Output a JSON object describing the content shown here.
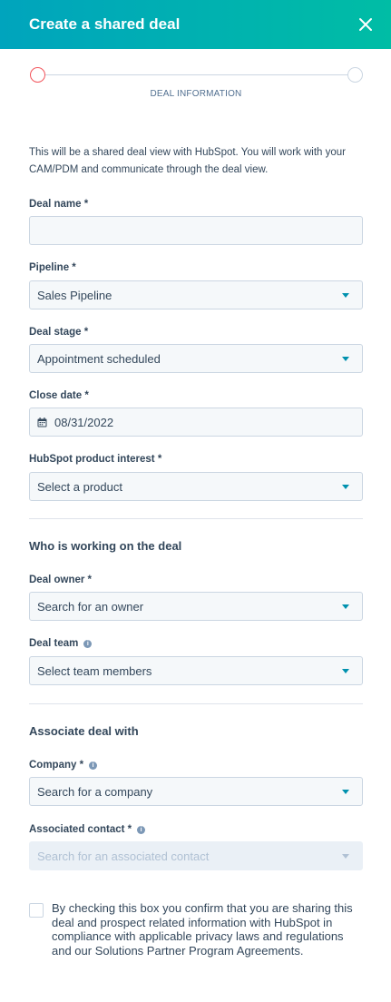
{
  "header": {
    "title": "Create a shared deal"
  },
  "stepper": {
    "label": "DEAL INFORMATION"
  },
  "intro": "This will be a shared deal view with HubSpot. You will work with your CAM/PDM and communicate through the deal view.",
  "fields": {
    "deal_name": {
      "label": "Deal name *",
      "value": ""
    },
    "pipeline": {
      "label": "Pipeline *",
      "value": "Sales Pipeline"
    },
    "deal_stage": {
      "label": "Deal stage *",
      "value": "Appointment scheduled"
    },
    "close_date": {
      "label": "Close date *",
      "value": "08/31/2022"
    },
    "product_interest": {
      "label": "HubSpot product interest *",
      "value": "Select a product"
    }
  },
  "sections": {
    "working": "Who is working on the deal",
    "associate": "Associate deal with"
  },
  "owner": {
    "deal_owner": {
      "label": "Deal owner *",
      "value": "Search for an owner"
    },
    "deal_team": {
      "label": "Deal team",
      "value": "Select team members"
    }
  },
  "associate": {
    "company": {
      "label": "Company *",
      "value": "Search for a company"
    },
    "contact": {
      "label": "Associated contact *",
      "value": "Search for an associated contact"
    }
  },
  "consent": "By checking this box you confirm that you are sharing this deal and prospect related information with HubSpot in compliance with applicable privacy laws and regulations and our Solutions Partner Program Agreements.",
  "colors": {
    "header_start": "#00a4bd",
    "header_end": "#00bda5",
    "accent": "#0091ae",
    "active_step": "#f2545b"
  },
  "icons": {
    "close": "close-icon",
    "calendar": "calendar-icon",
    "info": "info-icon",
    "dropdown": "chevron-down-icon"
  }
}
